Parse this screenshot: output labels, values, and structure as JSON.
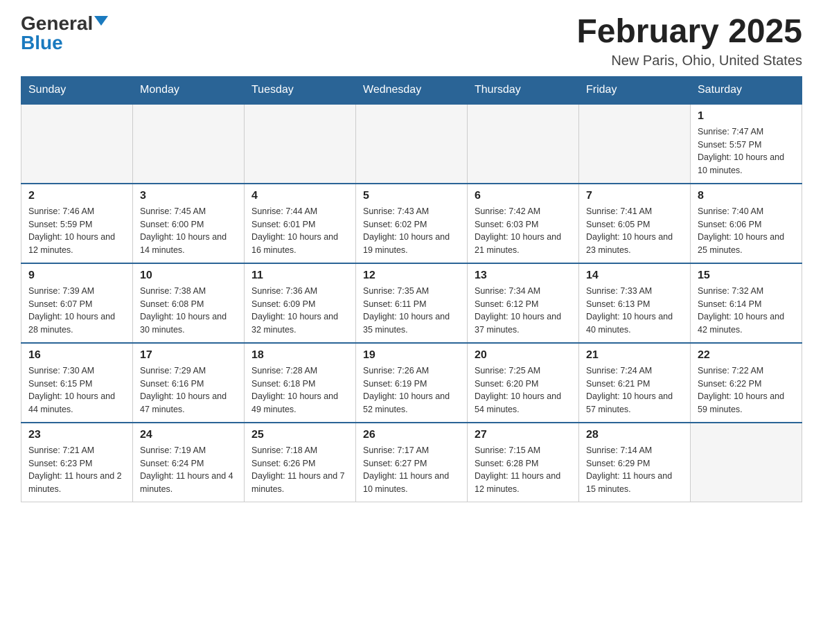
{
  "logo": {
    "general": "General",
    "blue": "Blue"
  },
  "title": "February 2025",
  "location": "New Paris, Ohio, United States",
  "days_of_week": [
    "Sunday",
    "Monday",
    "Tuesday",
    "Wednesday",
    "Thursday",
    "Friday",
    "Saturday"
  ],
  "weeks": [
    [
      {
        "day": "",
        "sunrise": "",
        "sunset": "",
        "daylight": ""
      },
      {
        "day": "",
        "sunrise": "",
        "sunset": "",
        "daylight": ""
      },
      {
        "day": "",
        "sunrise": "",
        "sunset": "",
        "daylight": ""
      },
      {
        "day": "",
        "sunrise": "",
        "sunset": "",
        "daylight": ""
      },
      {
        "day": "",
        "sunrise": "",
        "sunset": "",
        "daylight": ""
      },
      {
        "day": "",
        "sunrise": "",
        "sunset": "",
        "daylight": ""
      },
      {
        "day": "1",
        "sunrise": "Sunrise: 7:47 AM",
        "sunset": "Sunset: 5:57 PM",
        "daylight": "Daylight: 10 hours and 10 minutes."
      }
    ],
    [
      {
        "day": "2",
        "sunrise": "Sunrise: 7:46 AM",
        "sunset": "Sunset: 5:59 PM",
        "daylight": "Daylight: 10 hours and 12 minutes."
      },
      {
        "day": "3",
        "sunrise": "Sunrise: 7:45 AM",
        "sunset": "Sunset: 6:00 PM",
        "daylight": "Daylight: 10 hours and 14 minutes."
      },
      {
        "day": "4",
        "sunrise": "Sunrise: 7:44 AM",
        "sunset": "Sunset: 6:01 PM",
        "daylight": "Daylight: 10 hours and 16 minutes."
      },
      {
        "day": "5",
        "sunrise": "Sunrise: 7:43 AM",
        "sunset": "Sunset: 6:02 PM",
        "daylight": "Daylight: 10 hours and 19 minutes."
      },
      {
        "day": "6",
        "sunrise": "Sunrise: 7:42 AM",
        "sunset": "Sunset: 6:03 PM",
        "daylight": "Daylight: 10 hours and 21 minutes."
      },
      {
        "day": "7",
        "sunrise": "Sunrise: 7:41 AM",
        "sunset": "Sunset: 6:05 PM",
        "daylight": "Daylight: 10 hours and 23 minutes."
      },
      {
        "day": "8",
        "sunrise": "Sunrise: 7:40 AM",
        "sunset": "Sunset: 6:06 PM",
        "daylight": "Daylight: 10 hours and 25 minutes."
      }
    ],
    [
      {
        "day": "9",
        "sunrise": "Sunrise: 7:39 AM",
        "sunset": "Sunset: 6:07 PM",
        "daylight": "Daylight: 10 hours and 28 minutes."
      },
      {
        "day": "10",
        "sunrise": "Sunrise: 7:38 AM",
        "sunset": "Sunset: 6:08 PM",
        "daylight": "Daylight: 10 hours and 30 minutes."
      },
      {
        "day": "11",
        "sunrise": "Sunrise: 7:36 AM",
        "sunset": "Sunset: 6:09 PM",
        "daylight": "Daylight: 10 hours and 32 minutes."
      },
      {
        "day": "12",
        "sunrise": "Sunrise: 7:35 AM",
        "sunset": "Sunset: 6:11 PM",
        "daylight": "Daylight: 10 hours and 35 minutes."
      },
      {
        "day": "13",
        "sunrise": "Sunrise: 7:34 AM",
        "sunset": "Sunset: 6:12 PM",
        "daylight": "Daylight: 10 hours and 37 minutes."
      },
      {
        "day": "14",
        "sunrise": "Sunrise: 7:33 AM",
        "sunset": "Sunset: 6:13 PM",
        "daylight": "Daylight: 10 hours and 40 minutes."
      },
      {
        "day": "15",
        "sunrise": "Sunrise: 7:32 AM",
        "sunset": "Sunset: 6:14 PM",
        "daylight": "Daylight: 10 hours and 42 minutes."
      }
    ],
    [
      {
        "day": "16",
        "sunrise": "Sunrise: 7:30 AM",
        "sunset": "Sunset: 6:15 PM",
        "daylight": "Daylight: 10 hours and 44 minutes."
      },
      {
        "day": "17",
        "sunrise": "Sunrise: 7:29 AM",
        "sunset": "Sunset: 6:16 PM",
        "daylight": "Daylight: 10 hours and 47 minutes."
      },
      {
        "day": "18",
        "sunrise": "Sunrise: 7:28 AM",
        "sunset": "Sunset: 6:18 PM",
        "daylight": "Daylight: 10 hours and 49 minutes."
      },
      {
        "day": "19",
        "sunrise": "Sunrise: 7:26 AM",
        "sunset": "Sunset: 6:19 PM",
        "daylight": "Daylight: 10 hours and 52 minutes."
      },
      {
        "day": "20",
        "sunrise": "Sunrise: 7:25 AM",
        "sunset": "Sunset: 6:20 PM",
        "daylight": "Daylight: 10 hours and 54 minutes."
      },
      {
        "day": "21",
        "sunrise": "Sunrise: 7:24 AM",
        "sunset": "Sunset: 6:21 PM",
        "daylight": "Daylight: 10 hours and 57 minutes."
      },
      {
        "day": "22",
        "sunrise": "Sunrise: 7:22 AM",
        "sunset": "Sunset: 6:22 PM",
        "daylight": "Daylight: 10 hours and 59 minutes."
      }
    ],
    [
      {
        "day": "23",
        "sunrise": "Sunrise: 7:21 AM",
        "sunset": "Sunset: 6:23 PM",
        "daylight": "Daylight: 11 hours and 2 minutes."
      },
      {
        "day": "24",
        "sunrise": "Sunrise: 7:19 AM",
        "sunset": "Sunset: 6:24 PM",
        "daylight": "Daylight: 11 hours and 4 minutes."
      },
      {
        "day": "25",
        "sunrise": "Sunrise: 7:18 AM",
        "sunset": "Sunset: 6:26 PM",
        "daylight": "Daylight: 11 hours and 7 minutes."
      },
      {
        "day": "26",
        "sunrise": "Sunrise: 7:17 AM",
        "sunset": "Sunset: 6:27 PM",
        "daylight": "Daylight: 11 hours and 10 minutes."
      },
      {
        "day": "27",
        "sunrise": "Sunrise: 7:15 AM",
        "sunset": "Sunset: 6:28 PM",
        "daylight": "Daylight: 11 hours and 12 minutes."
      },
      {
        "day": "28",
        "sunrise": "Sunrise: 7:14 AM",
        "sunset": "Sunset: 6:29 PM",
        "daylight": "Daylight: 11 hours and 15 minutes."
      },
      {
        "day": "",
        "sunrise": "",
        "sunset": "",
        "daylight": ""
      }
    ]
  ]
}
